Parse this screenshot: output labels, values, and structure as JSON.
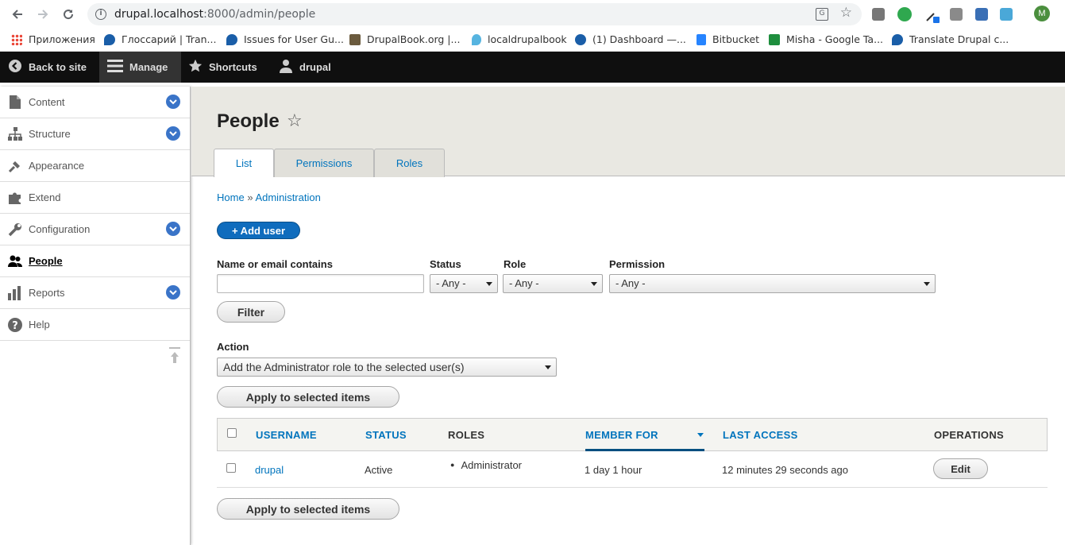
{
  "browser": {
    "url_host": "drupal.localhost",
    "url_rest": ":8000/admin/people",
    "avatar_letter": "M",
    "bookmarks": [
      {
        "label": "Приложения",
        "icon": "apps-grid-icon"
      },
      {
        "label": "Глоссарий | Tran...",
        "icon": "drupal-drop-icon"
      },
      {
        "label": "Issues for User Gu...",
        "icon": "drupal-drop-icon"
      },
      {
        "label": "DrupalBook.org |...",
        "icon": "book-icon"
      },
      {
        "label": "localdrupalbook",
        "icon": "water-drop-icon"
      },
      {
        "label": "(1) Dashboard —...",
        "icon": "dashboard-icon"
      },
      {
        "label": "Bitbucket",
        "icon": "bitbucket-icon"
      },
      {
        "label": "Misha - Google Ta...",
        "icon": "sheets-icon"
      },
      {
        "label": "Translate Drupal c...",
        "icon": "drupal-drop-icon"
      }
    ]
  },
  "toolbar": {
    "back": "Back to site",
    "manage": "Manage",
    "shortcuts": "Shortcuts",
    "user": "drupal"
  },
  "sidebar": {
    "items": [
      {
        "label": "Content",
        "icon": "file-icon",
        "expandable": true
      },
      {
        "label": "Structure",
        "icon": "structure-icon",
        "expandable": true
      },
      {
        "label": "Appearance",
        "icon": "brush-icon",
        "expandable": false
      },
      {
        "label": "Extend",
        "icon": "puzzle-icon",
        "expandable": false
      },
      {
        "label": "Configuration",
        "icon": "wrench-icon",
        "expandable": true
      },
      {
        "label": "People",
        "icon": "people-icon",
        "expandable": false
      },
      {
        "label": "Reports",
        "icon": "bar-chart-icon",
        "expandable": true
      },
      {
        "label": "Help",
        "icon": "help-icon",
        "expandable": false
      }
    ]
  },
  "page": {
    "title": "People",
    "tabs": [
      "List",
      "Permissions",
      "Roles"
    ],
    "breadcrumb": {
      "home": "Home",
      "sep": "»",
      "admin": "Administration"
    },
    "add_user": "+ Add user"
  },
  "filters": {
    "name_label": "Name or email contains",
    "name_value": "",
    "status_label": "Status",
    "status_value": "- Any -",
    "role_label": "Role",
    "role_value": "- Any -",
    "permission_label": "Permission",
    "permission_value": "- Any -",
    "filter_button": "Filter"
  },
  "action": {
    "label": "Action",
    "value": "Add the Administrator role to the selected user(s)",
    "apply_button": "Apply to selected items"
  },
  "table": {
    "headers": {
      "username": "USERNAME",
      "status": "STATUS",
      "roles": "ROLES",
      "member_for": "MEMBER FOR",
      "last_access": "LAST ACCESS",
      "operations": "OPERATIONS"
    },
    "rows": [
      {
        "username": "drupal",
        "status": "Active",
        "roles": "Administrator",
        "member_for": "1 day 1 hour",
        "last_access": "12 minutes 29 seconds ago",
        "operation": "Edit"
      }
    ]
  }
}
